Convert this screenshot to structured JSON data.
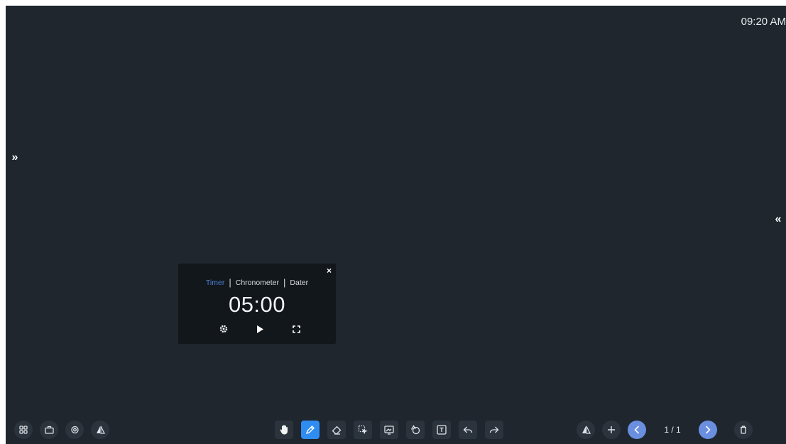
{
  "clock": {
    "time": "09:20 AM"
  },
  "edges": {
    "left_glyph": "»",
    "right_glyph": "«"
  },
  "timer": {
    "tabs": [
      {
        "label": "Timer",
        "active": true
      },
      {
        "label": "Chronometer",
        "active": false
      },
      {
        "label": "Dater",
        "active": false
      }
    ],
    "tab_separator": "|",
    "time": "05:00",
    "close_glyph": "×"
  },
  "toolbar": {
    "left_icons": [
      "apps-icon",
      "toolbox-icon",
      "screen-capture-icon",
      "split-screen-icon"
    ],
    "center_icons": [
      "hand-icon",
      "pen-icon",
      "eraser-icon",
      "select-icon",
      "insert-image-icon",
      "shapes-icon",
      "text-icon",
      "undo-icon",
      "redo-icon"
    ],
    "active_tool": "pen",
    "right_icons": [
      "mirror-icon",
      "add-page-icon",
      "prev-page-icon",
      "next-page-icon",
      "delete-page-icon"
    ],
    "page_indicator": "1 / 1"
  },
  "colors": {
    "background": "#1f262e",
    "accent": "#2f8cf0",
    "tab_active": "#4b7fd1",
    "nav_button": "#6a8fe0"
  }
}
